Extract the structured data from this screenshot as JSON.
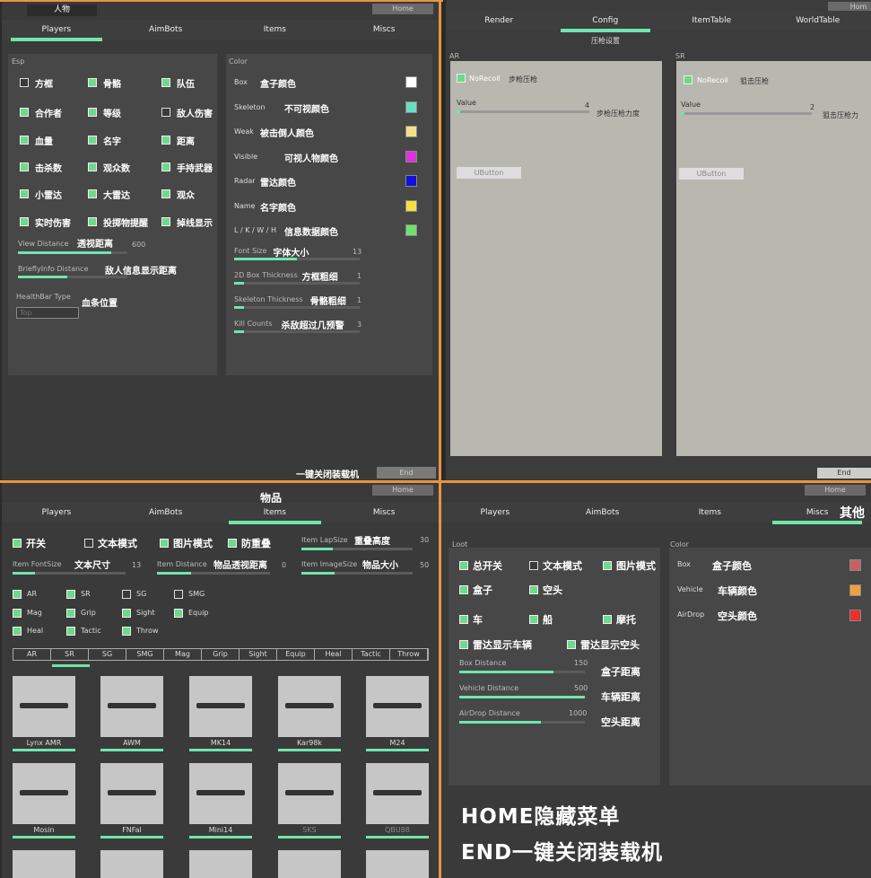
{
  "q1": {
    "title": "人物",
    "home": "Home",
    "tabs": [
      "Players",
      "AimBots",
      "Items",
      "Miscs"
    ],
    "esp": "Esp",
    "color": "Color",
    "checks": [
      [
        "方框",
        0
      ],
      [
        "骨骼",
        1
      ],
      [
        "队伍",
        1
      ],
      [
        "合作者",
        1
      ],
      [
        "等级",
        1
      ],
      [
        "敌人伤害",
        0
      ],
      [
        "血量",
        1
      ],
      [
        "名字",
        1
      ],
      [
        "距离",
        1
      ],
      [
        "击杀数",
        1
      ],
      [
        "观众数",
        1
      ],
      [
        "手持武器",
        1
      ],
      [
        "小雷达",
        1
      ],
      [
        "大雷达",
        1
      ],
      [
        "观众",
        1
      ],
      [
        "实时伤害",
        1
      ],
      [
        "投掷物提醒",
        1
      ],
      [
        "掉线显示",
        1
      ]
    ],
    "view_distance": {
      "label": "View Distance",
      "zh": "透视距离",
      "value": "600"
    },
    "brief": {
      "label": "BrieflyInfo Distance",
      "zh": "敌人信息显示距离"
    },
    "health": {
      "label": "HealthBar Type",
      "zh": "血条位置",
      "placeholder": "Top"
    },
    "colors": [
      {
        "en": "Box",
        "zh": "盒子颜色",
        "c": "#ffffff"
      },
      {
        "en": "Skeleton",
        "zh": "不可视颜色",
        "c": "#66e0c0"
      },
      {
        "en": "Weak",
        "zh": "被击倒人颜色",
        "c": "#f5e08a"
      },
      {
        "en": "Visible",
        "zh": "可视人物颜色",
        "c": "#e030e0"
      },
      {
        "en": "Radar",
        "zh": "雷达颜色",
        "c": "#1010dd"
      },
      {
        "en": "Name",
        "zh": "名字颜色",
        "c": "#f5e040"
      },
      {
        "en": "L / K / W / H",
        "zh": "信息数据颜色",
        "c": "#70e070"
      }
    ],
    "sliders": [
      {
        "en": "Font Size",
        "zh": "字体大小",
        "v": "13"
      },
      {
        "en": "2D Box Thickness",
        "zh": "方框粗细",
        "v": "1"
      },
      {
        "en": "Skeleton Thickness",
        "zh": "骨骼粗细",
        "v": "1"
      },
      {
        "en": "Kill Counts",
        "zh": "杀敌超过几预警",
        "v": "3"
      }
    ],
    "end_zh": "一键关闭装载机",
    "end": "End"
  },
  "q2": {
    "home": "Hom",
    "tabs": [
      "Render",
      "Config",
      "ItemTable",
      "WorldTable"
    ],
    "sub": "压枪设置",
    "ar": {
      "head": "AR",
      "no": "NoRecoil",
      "zh": "步枪压枪",
      "value": "Value",
      "v": "4",
      "vzh": "步枪压枪力度",
      "btn": "UButton"
    },
    "sr": {
      "head": "SR",
      "no": "NoRecoil",
      "zh": "狙击压枪",
      "value": "Value",
      "v": "2",
      "vzh": "狙击压枪力",
      "btn": "UButton"
    },
    "end": "End"
  },
  "q3": {
    "title": "物品",
    "home": "Home",
    "tabs": [
      "Players",
      "AimBots",
      "Items",
      "Miscs"
    ],
    "top": [
      [
        "开关",
        1
      ],
      [
        "文本模式",
        0
      ],
      [
        "图片模式",
        1
      ],
      [
        "防重叠",
        1
      ]
    ],
    "lap": {
      "en": "Item LapSize",
      "zh": "重叠高度",
      "v": "30"
    },
    "font": {
      "en": "Item FontSize",
      "zh": "文本尺寸",
      "v": "13"
    },
    "dist": {
      "en": "Item Distance",
      "zh": "物品透视距离",
      "v": "0"
    },
    "imgs": {
      "en": "Item ImageSize",
      "zh": "物品大小",
      "v": "50"
    },
    "cats": [
      [
        "AR",
        1
      ],
      [
        "SR",
        1
      ],
      [
        "SG",
        0
      ],
      [
        "SMG",
        0
      ],
      [
        "Mag",
        1
      ],
      [
        "Grip",
        1
      ],
      [
        "Sight",
        1
      ],
      [
        "Equip",
        1
      ],
      [
        "Heal",
        1
      ],
      [
        "Tactic",
        1
      ],
      [
        "Throw",
        1
      ]
    ],
    "ctabs": [
      "AR",
      "SR",
      "SG",
      "SMG",
      "Mag",
      "Grip",
      "Sight",
      "Equip",
      "Heal",
      "Tactic",
      "Throw"
    ],
    "items": [
      "Lynx AMR",
      "AWM",
      "MK14",
      "Kar98k",
      "M24",
      "Mosin",
      "FNFal",
      "Mini14",
      "SKS",
      "QBU88"
    ]
  },
  "q4": {
    "home": "Home",
    "tabs": [
      "Players",
      "AimBots",
      "Items",
      "Miscs"
    ],
    "misc_zh": "其他",
    "loot": "Loot",
    "color": "Color",
    "checks": [
      [
        "总开关",
        1
      ],
      [
        "文本模式",
        0
      ],
      [
        "图片模式",
        1
      ],
      [
        "盒子",
        1
      ],
      [
        "空头",
        1
      ],
      [
        "车",
        1
      ],
      [
        "船",
        1
      ],
      [
        "摩托",
        1
      ],
      [
        "雷达显示车辆",
        1
      ],
      [
        "雷达显示空头",
        1
      ]
    ],
    "dist": [
      {
        "en": "Box Distance",
        "v": "150",
        "zh": "盒子距离"
      },
      {
        "en": "Vehicle Distance",
        "v": "500",
        "zh": "车辆距离"
      },
      {
        "en": "AirDrop Distance",
        "v": "1000",
        "zh": "空头距离"
      }
    ],
    "colors": [
      {
        "en": "Box",
        "zh": "盒子颜色",
        "c": "#c86060"
      },
      {
        "en": "Vehicle",
        "zh": "车辆颜色",
        "c": "#f0a040"
      },
      {
        "en": "AirDrop",
        "zh": "空头颜色",
        "c": "#e83030"
      }
    ],
    "hint1": "HOME隐藏菜单",
    "hint2": "END一键关闭装载机"
  }
}
